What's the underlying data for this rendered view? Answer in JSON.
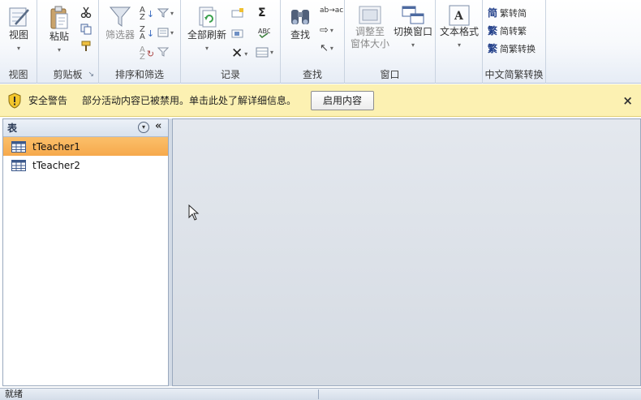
{
  "ribbon": {
    "groups": {
      "views": {
        "label": "视图",
        "view_button": "视图"
      },
      "clipboard": {
        "label": "剪贴板",
        "paste_button": "粘贴"
      },
      "sort_filter": {
        "label": "排序和筛选",
        "filter_button": "筛选器"
      },
      "records": {
        "label": "记录",
        "refresh_all_button": "全部刷新",
        "sum_symbol": "Σ"
      },
      "find": {
        "label": "查找",
        "find_button": "查找",
        "replace_glyph": "ab→ac"
      },
      "window": {
        "label": "窗口",
        "fit_line1": "调整至",
        "fit_line2": "窗体大小",
        "switch_windows_button": "切换窗口"
      },
      "text_formatting": {
        "label": "文本格式",
        "icon_letter": "A"
      },
      "chinese_conversion": {
        "label": "中文简繁转换",
        "trad_to_simp": "繁转简",
        "trad_to_simp_glyph": "简",
        "simp_to_trad": "简转繁",
        "simp_to_trad_glyph": "繁",
        "convert": "简繁转换",
        "convert_glyph": "繁"
      }
    }
  },
  "security_bar": {
    "title": "安全警告",
    "message": "部分活动内容已被禁用。单击此处了解详细信息。",
    "enable_button": "启用内容",
    "close_glyph": "×"
  },
  "nav_pane": {
    "title": "表",
    "collapse_glyph": "«",
    "dropdown_glyph": "▾",
    "items": [
      {
        "label": "tTeacher1",
        "selected": true
      },
      {
        "label": "tTeacher2",
        "selected": false
      }
    ]
  },
  "status_bar": {
    "text": "就绪"
  },
  "colors": {
    "accent_selected": "#f6a94c",
    "security_bar_bg": "#fcf1b2",
    "workspace_bg": "#dbe0e7"
  },
  "icons": [
    "view-icon",
    "paste-icon",
    "cut-icon",
    "copy-icon",
    "format-painter-icon",
    "filter-icon",
    "refresh-icon",
    "sum-icon",
    "binoculars-icon",
    "shield-warning-icon",
    "table-icon"
  ]
}
